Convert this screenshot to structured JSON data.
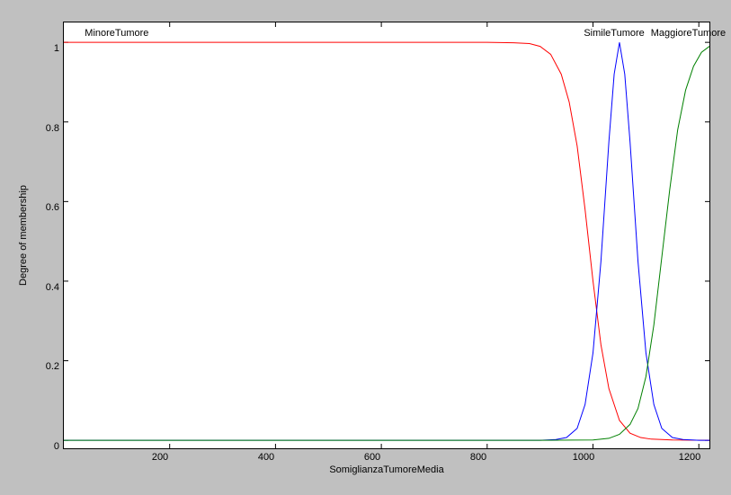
{
  "chart_data": {
    "type": "line",
    "title": "",
    "xlabel": "SomiglianzaTumoreMedia",
    "ylabel": "Degree of membership",
    "xlim": [
      0,
      1220
    ],
    "ylim": [
      -0.02,
      1.05
    ],
    "xticks": [
      200,
      400,
      600,
      800,
      1000,
      1200
    ],
    "yticks": [
      0,
      0.2,
      0.4,
      0.6,
      0.8,
      1
    ],
    "series": [
      {
        "name": "MinoreTumore",
        "label_pos": {
          "x": 100,
          "y_top": 1.02
        },
        "color": "#ff0000",
        "x": [
          0,
          200,
          400,
          600,
          800,
          850,
          880,
          900,
          920,
          940,
          955,
          970,
          985,
          1000,
          1015,
          1030,
          1050,
          1070,
          1090,
          1110,
          1150,
          1220
        ],
        "y": [
          1,
          1,
          1,
          1,
          1,
          0.999,
          0.997,
          0.99,
          0.97,
          0.92,
          0.85,
          0.74,
          0.58,
          0.4,
          0.24,
          0.13,
          0.05,
          0.018,
          0.007,
          0.003,
          0.001,
          0
        ]
      },
      {
        "name": "SimileTumore",
        "label_pos": {
          "x": 1040,
          "y_top": 1.02
        },
        "color": "#0000ff",
        "x": [
          0,
          900,
          930,
          950,
          970,
          985,
          1000,
          1015,
          1030,
          1040,
          1050,
          1060,
          1070,
          1085,
          1100,
          1115,
          1130,
          1150,
          1170,
          1200,
          1220
        ],
        "y": [
          0,
          0,
          0.002,
          0.007,
          0.03,
          0.09,
          0.22,
          0.45,
          0.75,
          0.92,
          1.0,
          0.92,
          0.75,
          0.45,
          0.22,
          0.09,
          0.03,
          0.007,
          0.002,
          0,
          0
        ]
      },
      {
        "name": "MaggioreTumore",
        "label_pos": {
          "x": 1180,
          "y_top": 1.02
        },
        "color": "#008000",
        "x": [
          0,
          900,
          1000,
          1030,
          1050,
          1070,
          1085,
          1100,
          1115,
          1130,
          1145,
          1160,
          1175,
          1190,
          1205,
          1220
        ],
        "y": [
          0,
          0,
          0.001,
          0.005,
          0.015,
          0.04,
          0.08,
          0.16,
          0.29,
          0.46,
          0.63,
          0.78,
          0.88,
          0.94,
          0.975,
          0.99
        ]
      }
    ]
  },
  "labels": {
    "xlabel": "SomiglianzaTumoreMedia",
    "ylabel": "Degree of membership",
    "series0": "MinoreTumore",
    "series1": "SimileTumore",
    "series2": "MaggioreTumore",
    "xt200": "200",
    "xt400": "400",
    "xt600": "600",
    "xt800": "800",
    "xt1000": "1000",
    "xt1200": "1200",
    "yt0": "0",
    "yt02": "0.2",
    "yt04": "0.4",
    "yt06": "0.6",
    "yt08": "0.8",
    "yt1": "1"
  }
}
